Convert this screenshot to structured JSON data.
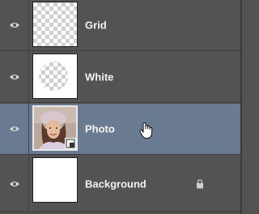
{
  "layers_panel": {
    "layers": [
      {
        "name": "Grid",
        "visible": true,
        "selected": false,
        "thumbnail": "checkerboard",
        "locked": false
      },
      {
        "name": "White",
        "visible": true,
        "selected": false,
        "thumbnail": "white-with-checker-circle",
        "locked": false
      },
      {
        "name": "Photo",
        "visible": true,
        "selected": true,
        "thumbnail": "photo-smart-object",
        "locked": false
      },
      {
        "name": "Background",
        "visible": true,
        "selected": false,
        "thumbnail": "white",
        "locked": true
      }
    ]
  },
  "colors": {
    "panel_bg": "#535353",
    "selected_row_bg": "#6a7a90",
    "text": "#f2f2f2"
  },
  "icons": [
    "eye-icon",
    "lock-icon",
    "smart-object-badge-icon",
    "hand-pointer-cursor-icon"
  ]
}
